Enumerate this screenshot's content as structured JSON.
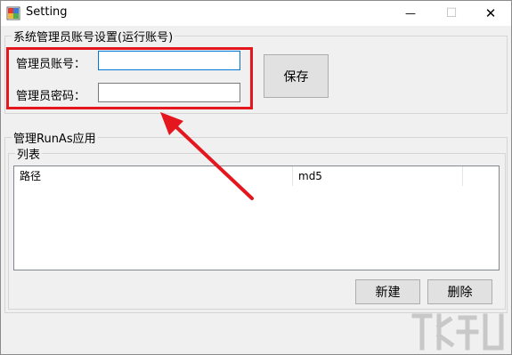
{
  "window": {
    "title": "Setting",
    "minimize_glyph": "—",
    "maximize_glyph": "☐",
    "close_glyph": "✕"
  },
  "admin_group": {
    "legend": "系统管理员账号设置(运行账号)",
    "account_label": "管理员账号：",
    "account_value": "",
    "password_label": "管理员密码：",
    "password_value": "",
    "save_button": "保存"
  },
  "runas_group": {
    "legend": "管理RunAs应用",
    "list_group": {
      "legend": "列表",
      "columns": [
        "路径",
        "md5"
      ],
      "rows": []
    },
    "new_button": "新建",
    "delete_button": "删除"
  },
  "icons": {
    "app": "app-icon",
    "minimize": "minimize-icon",
    "maximize": "maximize-icon",
    "close": "close-icon"
  },
  "annotation": {
    "highlight_color": "#e4171e"
  }
}
